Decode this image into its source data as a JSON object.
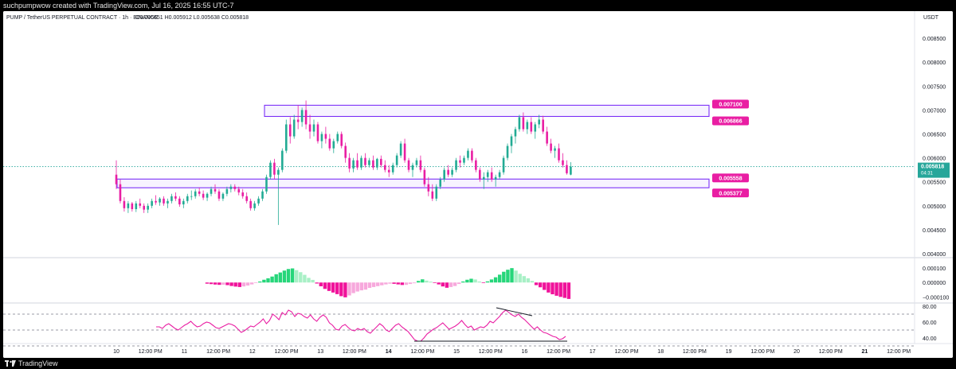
{
  "header": {
    "caption": "suchpumpwow created with TradingView.com, Jul 16, 2025 16:55 UTC-7"
  },
  "chart_header": {
    "symbol_line": "PUMP / TetherUS PERPETUAL CONTRACT · 1h · BINANCE",
    "ohlc": "O0.005651 H0.005912 L0.005638 C0.005818",
    "currency": "USDT"
  },
  "footer": {
    "brand": "TradingView"
  },
  "colors": {
    "up": "#22ab94",
    "down": "#e91ea3",
    "zone": "#7b2ff7",
    "zone_label": "#e91ea3",
    "price_line": "#26a69a",
    "price_label": "#26a69a",
    "rsi": "#e91ea3",
    "hist_up_strong": "#26d67a",
    "hist_up_weak": "#a8f0c6",
    "hist_down_strong": "#f0129a",
    "hist_down_weak": "#f7a8dc"
  },
  "chart_data": [
    {
      "type": "candlestick",
      "title": "PUMP / TetherUS PERPETUAL CONTRACT · 1h · BINANCE",
      "ylim": [
        0.004,
        0.0088
      ],
      "y_ticks": [
        "0.008500",
        "0.008000",
        "0.007500",
        "0.007000",
        "0.006500",
        "0.006000",
        "0.005500",
        "0.005000",
        "0.004500",
        "0.004000"
      ],
      "x_ticks": [
        "10",
        "12:00 PM",
        "11",
        "12:00 PM",
        "12",
        "12:00 PM",
        "13",
        "12:00 PM",
        "14",
        "12:00 PM",
        "15",
        "12:00 PM",
        "16",
        "12:00 PM",
        "17",
        "12:00 PM",
        "18",
        "12:00 PM",
        "19",
        "12:00 PM",
        "20",
        "12:00 PM",
        "21",
        "12:00 PM"
      ],
      "x_tick_style": [
        "day",
        "time",
        "day",
        "time",
        "day",
        "time",
        "day",
        "time",
        "bold",
        "time",
        "day",
        "time",
        "day",
        "time",
        "day",
        "time",
        "day",
        "time",
        "day",
        "time",
        "day",
        "time",
        "bold",
        "time"
      ],
      "ohlc": [
        [
          0.00565,
          0.00595,
          0.00535,
          0.00545
        ],
        [
          0.00545,
          0.00555,
          0.00505,
          0.0051
        ],
        [
          0.0051,
          0.00518,
          0.00488,
          0.00495
        ],
        [
          0.00495,
          0.0051,
          0.00485,
          0.00505
        ],
        [
          0.00505,
          0.00508,
          0.00488,
          0.00493
        ],
        [
          0.00493,
          0.0051,
          0.00487,
          0.00505
        ],
        [
          0.00505,
          0.00515,
          0.00495,
          0.005
        ],
        [
          0.005,
          0.00505,
          0.00485,
          0.00492
        ],
        [
          0.00492,
          0.00505,
          0.00485,
          0.005
        ],
        [
          0.005,
          0.00515,
          0.00495,
          0.0051
        ],
        [
          0.0051,
          0.00522,
          0.00502,
          0.00507
        ],
        [
          0.00507,
          0.00518,
          0.005,
          0.00515
        ],
        [
          0.00515,
          0.0052,
          0.005,
          0.00505
        ],
        [
          0.00505,
          0.00515,
          0.00495,
          0.0051
        ],
        [
          0.0051,
          0.00525,
          0.00505,
          0.0052
        ],
        [
          0.0052,
          0.00528,
          0.0051,
          0.00515
        ],
        [
          0.00515,
          0.0052,
          0.00498,
          0.00503
        ],
        [
          0.00503,
          0.00515,
          0.00495,
          0.0051
        ],
        [
          0.0051,
          0.00525,
          0.00505,
          0.0052
        ],
        [
          0.0052,
          0.00532,
          0.00512,
          0.0052
        ],
        [
          0.0052,
          0.00535,
          0.00515,
          0.0053
        ],
        [
          0.0053,
          0.00538,
          0.0052,
          0.00525
        ],
        [
          0.00525,
          0.00532,
          0.00512,
          0.00517
        ],
        [
          0.00517,
          0.00528,
          0.0051,
          0.00525
        ],
        [
          0.00525,
          0.0054,
          0.0052,
          0.00535
        ],
        [
          0.00535,
          0.00545,
          0.00525,
          0.0053
        ],
        [
          0.0053,
          0.00535,
          0.0051,
          0.00515
        ],
        [
          0.00515,
          0.00528,
          0.0051,
          0.00525
        ],
        [
          0.00525,
          0.0054,
          0.0052,
          0.00535
        ],
        [
          0.00535,
          0.00545,
          0.00528,
          0.0054
        ],
        [
          0.0054,
          0.00545,
          0.0053,
          0.00535
        ],
        [
          0.00535,
          0.0054,
          0.00522,
          0.00528
        ],
        [
          0.00528,
          0.00535,
          0.00515,
          0.0052
        ],
        [
          0.0052,
          0.00528,
          0.00505,
          0.0051
        ],
        [
          0.0051,
          0.00515,
          0.0049,
          0.00495
        ],
        [
          0.00495,
          0.0051,
          0.0049,
          0.00505
        ],
        [
          0.00505,
          0.0052,
          0.005,
          0.00515
        ],
        [
          0.00515,
          0.00535,
          0.0051,
          0.0053
        ],
        [
          0.0053,
          0.00565,
          0.00525,
          0.0056
        ],
        [
          0.0056,
          0.00595,
          0.00555,
          0.0059
        ],
        [
          0.0059,
          0.00598,
          0.00555,
          0.00565
        ],
        [
          0.00565,
          0.0058,
          0.0046,
          0.00575
        ],
        [
          0.00575,
          0.0062,
          0.0057,
          0.00615
        ],
        [
          0.00615,
          0.0068,
          0.0061,
          0.0067
        ],
        [
          0.0067,
          0.00685,
          0.0063,
          0.00645
        ],
        [
          0.00645,
          0.0069,
          0.0064,
          0.0068
        ],
        [
          0.0068,
          0.0071,
          0.0066,
          0.00675
        ],
        [
          0.00675,
          0.00705,
          0.00665,
          0.007
        ],
        [
          0.007,
          0.0072,
          0.0066,
          0.0067
        ],
        [
          0.0067,
          0.0069,
          0.0064,
          0.00655
        ],
        [
          0.00655,
          0.0068,
          0.00645,
          0.0067
        ],
        [
          0.0067,
          0.00675,
          0.0063,
          0.00635
        ],
        [
          0.00635,
          0.00655,
          0.0062,
          0.0065
        ],
        [
          0.0065,
          0.00665,
          0.0063,
          0.0064
        ],
        [
          0.0064,
          0.0065,
          0.00615,
          0.0062
        ],
        [
          0.0062,
          0.0064,
          0.0061,
          0.00635
        ],
        [
          0.00635,
          0.00655,
          0.0063,
          0.0065
        ],
        [
          0.0065,
          0.00655,
          0.0062,
          0.00625
        ],
        [
          0.00625,
          0.00632,
          0.0059,
          0.006
        ],
        [
          0.006,
          0.0061,
          0.0057,
          0.00578
        ],
        [
          0.00578,
          0.006,
          0.0057,
          0.00595
        ],
        [
          0.00595,
          0.0061,
          0.00575,
          0.0058
        ],
        [
          0.0058,
          0.00605,
          0.00575,
          0.006
        ],
        [
          0.006,
          0.0061,
          0.0058,
          0.00585
        ],
        [
          0.00585,
          0.006,
          0.0058,
          0.00595
        ],
        [
          0.00595,
          0.00605,
          0.00575,
          0.0058
        ],
        [
          0.0058,
          0.006,
          0.00575,
          0.00598
        ],
        [
          0.00598,
          0.00605,
          0.0058,
          0.00585
        ],
        [
          0.00585,
          0.00595,
          0.0057,
          0.00575
        ],
        [
          0.00575,
          0.00585,
          0.0056,
          0.0057
        ],
        [
          0.0057,
          0.0059,
          0.00565,
          0.00585
        ],
        [
          0.00585,
          0.0061,
          0.0058,
          0.00605
        ],
        [
          0.00605,
          0.00635,
          0.006,
          0.0063
        ],
        [
          0.0063,
          0.0064,
          0.0059,
          0.00595
        ],
        [
          0.00595,
          0.006,
          0.0057,
          0.00575
        ],
        [
          0.00575,
          0.0059,
          0.0056,
          0.00585
        ],
        [
          0.00585,
          0.006,
          0.0058,
          0.00595
        ],
        [
          0.00595,
          0.00605,
          0.0057,
          0.00575
        ],
        [
          0.00575,
          0.0058,
          0.0054,
          0.00545
        ],
        [
          0.00545,
          0.0056,
          0.0052,
          0.0053
        ],
        [
          0.0053,
          0.00545,
          0.0051,
          0.00515
        ],
        [
          0.00515,
          0.00545,
          0.0051,
          0.0054
        ],
        [
          0.0054,
          0.0056,
          0.00535,
          0.00555
        ],
        [
          0.00555,
          0.0058,
          0.0055,
          0.00575
        ],
        [
          0.00575,
          0.00585,
          0.0056,
          0.00565
        ],
        [
          0.00565,
          0.0058,
          0.0056,
          0.00575
        ],
        [
          0.00575,
          0.006,
          0.0057,
          0.00595
        ],
        [
          0.00595,
          0.00605,
          0.0058,
          0.0059
        ],
        [
          0.0059,
          0.00605,
          0.00585,
          0.006
        ],
        [
          0.006,
          0.0062,
          0.00595,
          0.00615
        ],
        [
          0.00615,
          0.0062,
          0.0059,
          0.00595
        ],
        [
          0.00595,
          0.006,
          0.0057,
          0.00575
        ],
        [
          0.00575,
          0.0058,
          0.0055,
          0.00555
        ],
        [
          0.00555,
          0.0057,
          0.00535,
          0.0056
        ],
        [
          0.0056,
          0.00575,
          0.0055,
          0.0057
        ],
        [
          0.0057,
          0.0058,
          0.0055,
          0.00555
        ],
        [
          0.00555,
          0.00565,
          0.0054,
          0.0056
        ],
        [
          0.0056,
          0.00575,
          0.00555,
          0.0057
        ],
        [
          0.0057,
          0.00605,
          0.00565,
          0.006
        ],
        [
          0.006,
          0.0063,
          0.00595,
          0.00625
        ],
        [
          0.00625,
          0.0065,
          0.0061,
          0.00645
        ],
        [
          0.00645,
          0.00665,
          0.0063,
          0.0066
        ],
        [
          0.0066,
          0.0069,
          0.00655,
          0.00685
        ],
        [
          0.00685,
          0.00695,
          0.00655,
          0.0066
        ],
        [
          0.0066,
          0.0068,
          0.0065,
          0.00675
        ],
        [
          0.00675,
          0.00685,
          0.0065,
          0.00655
        ],
        [
          0.00655,
          0.00675,
          0.0064,
          0.0067
        ],
        [
          0.0067,
          0.0069,
          0.00662,
          0.0068
        ],
        [
          0.0068,
          0.00688,
          0.0065,
          0.00655
        ],
        [
          0.00655,
          0.00665,
          0.00625,
          0.0063
        ],
        [
          0.0063,
          0.0064,
          0.0061,
          0.00615
        ],
        [
          0.00615,
          0.00625,
          0.006,
          0.0062
        ],
        [
          0.0062,
          0.0063,
          0.0059,
          0.00595
        ],
        [
          0.00595,
          0.0061,
          0.0058,
          0.00585
        ],
        [
          0.00585,
          0.00595,
          0.00565,
          0.00568
        ],
        [
          0.005651,
          0.005912,
          0.005638,
          0.005818
        ]
      ],
      "zones": [
        {
          "upper": 0.0071,
          "lower": 0.006866,
          "labels": [
            "0.007100",
            "0.006866"
          ]
        },
        {
          "upper": 0.005558,
          "lower": 0.005377,
          "labels": [
            "0.005558",
            "0.005377"
          ]
        }
      ],
      "last_price": {
        "value": "0.005818",
        "countdown": "04:31",
        "level": 0.005818
      }
    },
    {
      "type": "bar",
      "title": "",
      "ylim": [
        -0.00013,
        0.00016
      ],
      "y_ticks": [
        "0.000100",
        "0.000000",
        "−0.000100"
      ],
      "values": [
        -8e-06,
        -1.1e-05,
        -1.4e-05,
        -1.6e-05,
        -1.5e-05,
        -1.8e-05,
        -2.4e-05,
        -2.8e-05,
        -3.1e-05,
        -2.7e-05,
        -2.1e-05,
        -1.3e-05,
        -4e-06,
        7e-06,
        1.9e-05,
        2.9e-05,
        4.1e-05,
        5.7e-05,
        6.9e-05,
        8.2e-05,
        9.3e-05,
        9.7e-05,
        8.5e-05,
        7.1e-05,
        5.3e-05,
        3.2e-05,
        1.8e-05,
        -7e-06,
        -2.6e-05,
        -4.4e-05,
        -5.8e-05,
        -6.9e-05,
        -8e-05,
        -9.4e-05,
        -0.000102,
        -8.9e-05,
        -7.3e-05,
        -6.2e-05,
        -5.4e-05,
        -4.9e-05,
        -3.7e-05,
        -3.1e-05,
        -2.5e-05,
        -1.9e-05,
        -1.3e-05,
        -8e-06,
        -9e-06,
        -1.3e-05,
        -1.7e-05,
        -1.6e-05,
        -1e-05,
        -5e-06,
        1.1e-05,
        2.2e-05,
        1.3e-05,
        6e-06,
        -4e-06,
        -1.3e-05,
        -2.7e-05,
        -3.6e-05,
        -3.1e-05,
        -2.4e-05,
        -1e-05,
        7e-06,
        1.9e-05,
        2.6e-05,
        2.1e-05,
        7e-06,
        -4e-06,
        8e-06,
        2.1e-05,
        3.6e-05,
        5.4e-05,
        7.4e-05,
        8.8e-05,
        9.9e-05,
        8.2e-05,
        6e-05,
        4.4e-05,
        2.9e-05,
        1.1e-05,
        -1.8e-05,
        -3.3e-05,
        -5.1e-05,
        -6.9e-05,
        -8.1e-05,
        -9.1e-05,
        -9.9e-05,
        -0.000106,
        -0.000113
      ]
    },
    {
      "type": "line",
      "title": "",
      "ylim": [
        35,
        82
      ],
      "y_ticks": [
        "80.00",
        "60.00",
        "40.00"
      ],
      "values": [
        54,
        54,
        52,
        56,
        58,
        55,
        52,
        50,
        53,
        56,
        58,
        61,
        57,
        54,
        55,
        58,
        60,
        59,
        56,
        53,
        52,
        54,
        56,
        58,
        57,
        55,
        51,
        47,
        49,
        52,
        55,
        54,
        57,
        60,
        64,
        58,
        62,
        70,
        67,
        63,
        72,
        69,
        75,
        73,
        67,
        71,
        70,
        67,
        65,
        69,
        64,
        61,
        66,
        69,
        66,
        59,
        56,
        51,
        50,
        55,
        57,
        53,
        50,
        49,
        52,
        50,
        52,
        48,
        46,
        50,
        54,
        58,
        55,
        50,
        48,
        52,
        56,
        58,
        54,
        51,
        48,
        43,
        38,
        36,
        36,
        40,
        45,
        48,
        51,
        53,
        56,
        59,
        55,
        51,
        53,
        55,
        58,
        62,
        57,
        53,
        55,
        50,
        52,
        54,
        53,
        56,
        61,
        59,
        63,
        67,
        72,
        75,
        72,
        69,
        67,
        70,
        66,
        63,
        59,
        55,
        51,
        54,
        50,
        47,
        46,
        44,
        42,
        41,
        38,
        39,
        42
      ],
      "levels": [
        70,
        50,
        30
      ]
    }
  ]
}
